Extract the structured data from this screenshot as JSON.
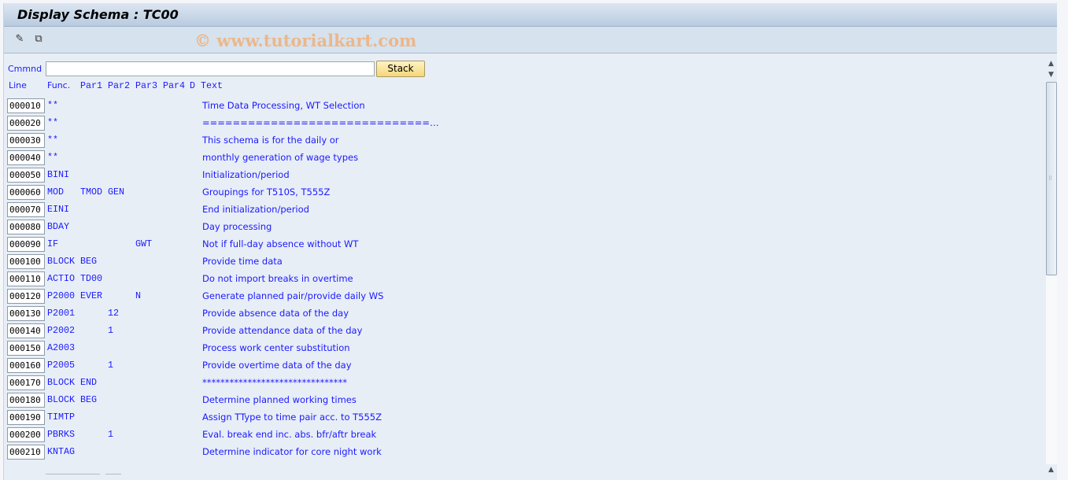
{
  "title": "Display Schema : TC00",
  "toolbar": {
    "icons": [
      "pencil-glasses-icon",
      "other-object-icon"
    ],
    "watermark": "© www.tutorialkart.com"
  },
  "command": {
    "label": "Cmmnd",
    "value": "",
    "stack_label": "Stack"
  },
  "columns": {
    "line": "Line",
    "func": "Func.",
    "par1": "Par1",
    "par2": "Par2",
    "par3": "Par3",
    "par4": "Par4",
    "d": "D",
    "text": "Text"
  },
  "rows": [
    {
      "line": "000010",
      "func": "**",
      "par1": "",
      "par2": "",
      "par3": "",
      "par4": "",
      "d": "",
      "text": "Time Data Processing, WT Selection"
    },
    {
      "line": "000020",
      "func": "**",
      "par1": "",
      "par2": "",
      "par3": "",
      "par4": "",
      "d": "",
      "text": "==============================…"
    },
    {
      "line": "000030",
      "func": "**",
      "par1": "",
      "par2": "",
      "par3": "",
      "par4": "",
      "d": "",
      "text": "This schema is for the daily or"
    },
    {
      "line": "000040",
      "func": "**",
      "par1": "",
      "par2": "",
      "par3": "",
      "par4": "",
      "d": "",
      "text": "monthly generation of wage types"
    },
    {
      "line": "000050",
      "func": "BINI",
      "par1": "",
      "par2": "",
      "par3": "",
      "par4": "",
      "d": "",
      "text": "Initialization/period"
    },
    {
      "line": "000060",
      "func": "MOD",
      "par1": "TMOD",
      "par2": "GEN",
      "par3": "",
      "par4": "",
      "d": "",
      "text": "Groupings for T510S, T555Z"
    },
    {
      "line": "000070",
      "func": "EINI",
      "par1": "",
      "par2": "",
      "par3": "",
      "par4": "",
      "d": "",
      "text": "End initialization/period"
    },
    {
      "line": "000080",
      "func": "BDAY",
      "par1": "",
      "par2": "",
      "par3": "",
      "par4": "",
      "d": "",
      "text": "Day processing"
    },
    {
      "line": "000090",
      "func": "IF",
      "par1": "",
      "par2": "",
      "par3": "GWT",
      "par4": "",
      "d": "",
      "text": "Not if full-day absence without WT"
    },
    {
      "line": "000100",
      "func": "BLOCK",
      "par1": "BEG",
      "par2": "",
      "par3": "",
      "par4": "",
      "d": "",
      "text": "Provide time data"
    },
    {
      "line": "000110",
      "func": "ACTIO",
      "par1": "TD00",
      "par2": "",
      "par3": "",
      "par4": "",
      "d": "",
      "text": "Do not import breaks in overtime"
    },
    {
      "line": "000120",
      "func": "P2000",
      "par1": "EVER",
      "par2": "",
      "par3": "N",
      "par4": "",
      "d": "",
      "text": "Generate planned pair/provide daily WS"
    },
    {
      "line": "000130",
      "func": "P2001",
      "par1": "",
      "par2": "12",
      "par3": "",
      "par4": "",
      "d": "",
      "text": "Provide absence data of the day"
    },
    {
      "line": "000140",
      "func": "P2002",
      "par1": "",
      "par2": "1",
      "par3": "",
      "par4": "",
      "d": "",
      "text": "Provide attendance data of the day"
    },
    {
      "line": "000150",
      "func": "A2003",
      "par1": "",
      "par2": "",
      "par3": "",
      "par4": "",
      "d": "",
      "text": "Process work center substitution"
    },
    {
      "line": "000160",
      "func": "P2005",
      "par1": "",
      "par2": "1",
      "par3": "",
      "par4": "",
      "d": "",
      "text": "Provide overtime data of the day"
    },
    {
      "line": "000170",
      "func": "BLOCK",
      "par1": "END",
      "par2": "",
      "par3": "",
      "par4": "",
      "d": "",
      "text": "********************************"
    },
    {
      "line": "000180",
      "func": "BLOCK",
      "par1": "BEG",
      "par2": "",
      "par3": "",
      "par4": "",
      "d": "",
      "text": "Determine planned working times"
    },
    {
      "line": "000190",
      "func": "TIMTP",
      "par1": "",
      "par2": "",
      "par3": "",
      "par4": "",
      "d": "",
      "text": "Assign TType to time pair acc. to T555Z"
    },
    {
      "line": "000200",
      "func": "PBRKS",
      "par1": "",
      "par2": "1",
      "par3": "",
      "par4": "",
      "d": "",
      "text": "Eval. break end inc. abs. bfr/aftr break"
    },
    {
      "line": "000210",
      "func": "KNTAG",
      "par1": "",
      "par2": "",
      "par3": "",
      "par4": "",
      "d": "",
      "text": "Determine indicator for core night work"
    }
  ]
}
